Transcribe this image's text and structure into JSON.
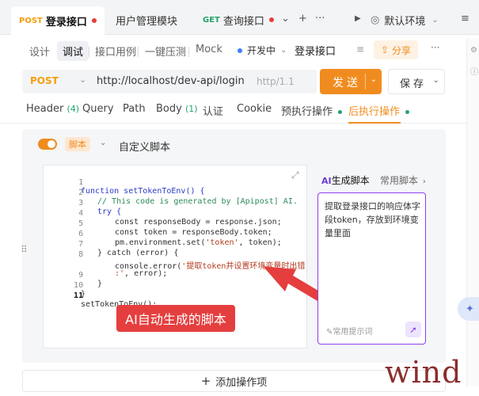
{
  "tabs": [
    {
      "method": "POST",
      "title": "登录接口",
      "active": true
    },
    {
      "method": "",
      "title": "用户管理模块",
      "active": false
    },
    {
      "method": "GET",
      "title": "查询接口",
      "active": false
    }
  ],
  "tabbar": {
    "more_label": "···",
    "environment": "默认环境"
  },
  "subnav": {
    "items": [
      "设计",
      "调试",
      "接口用例",
      "一键压测",
      "Mock"
    ],
    "active": "调试",
    "status": "开发中",
    "api_name": "登录接口",
    "share": "分享",
    "more": "···"
  },
  "request": {
    "method": "POST",
    "url": "http://localhost/dev-api/login",
    "protocol": "http/1.1",
    "send": "发送",
    "save": "保存"
  },
  "req_tabs": [
    {
      "label": "Header",
      "count": "(4)"
    },
    {
      "label": "Query",
      "count": ""
    },
    {
      "label": "Path",
      "count": ""
    },
    {
      "label": "Body",
      "count": "(1)"
    },
    {
      "label": "认证",
      "count": ""
    },
    {
      "label": "Cookie",
      "count": ""
    },
    {
      "label": "预执行操作",
      "count": ""
    },
    {
      "label": "后执行操作",
      "count": ""
    }
  ],
  "script": {
    "badge": "脚本",
    "title": "自定义脚本",
    "line_numbers": [
      "1",
      "2",
      "3",
      "4",
      "5",
      "6",
      "7",
      "8",
      "",
      "9",
      "10",
      "11"
    ],
    "code": {
      "l1": "function setTokenToEnv() {",
      "l2": "// This code is generated by [Apipost] AI.",
      "l3": "try {",
      "l4": "const responseBody = response.json;",
      "l5": "const token = responseBody.token;",
      "l6a": "pm.environment.set(",
      "l6b": "'token'",
      "l6c": ", token);",
      "l7": "} catch (error) {",
      "l8a": "console.error(",
      "l8b": "'提取token并设置环境变量时出错",
      "l8c": ":'",
      "l8d": ", error);",
      "l9": "}",
      "l10": "}",
      "l11": "setTokenToEnv();"
    },
    "callout": "AI自动生成的脚本"
  },
  "ai": {
    "tab_active": "生成脚本",
    "tab_badge": "AI",
    "tab_other": "常用脚本",
    "prompt": "提取登录接口的响应体字段token，存放到环境变量里面",
    "hint": "常用提示词"
  },
  "footer": {
    "add_operation": "添加操作项"
  },
  "watermark": "wind",
  "colors": {
    "accent": "#f08c1f",
    "ai_border": "#8a3ff0",
    "callout": "#e53e3e"
  }
}
